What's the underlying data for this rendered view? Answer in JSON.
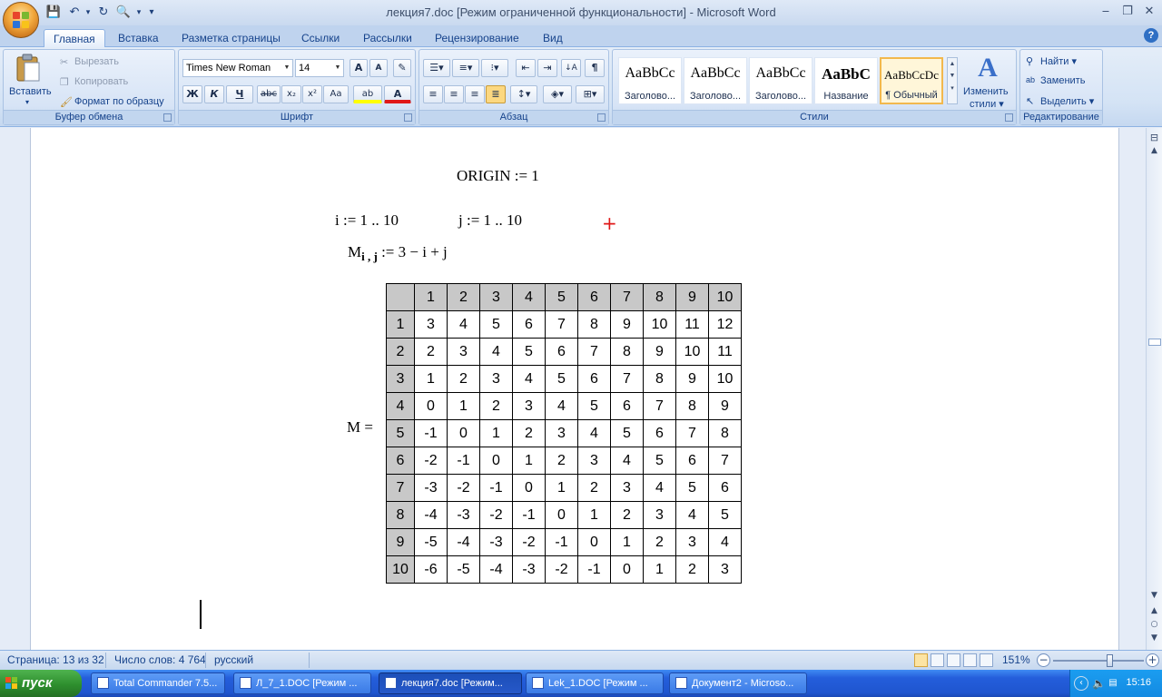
{
  "window": {
    "title": "лекция7.doc [Режим ограниченной функциональности] - Microsoft Word",
    "minimize": "‒",
    "restore": "❐",
    "close": "✕"
  },
  "qat": {
    "save": "💾",
    "undo": "↶",
    "redo": "↻",
    "preview": "🔍",
    "customize": "▾"
  },
  "tabs": [
    "Главная",
    "Вставка",
    "Разметка страницы",
    "Ссылки",
    "Рассылки",
    "Рецензирование",
    "Вид"
  ],
  "ribbon": {
    "clipboard": {
      "label": "Буфер обмена",
      "paste": "Вставить",
      "cut": "Вырезать",
      "copy": "Копировать",
      "format_painter": "Формат по образцу"
    },
    "font": {
      "label": "Шрифт",
      "font_name": "Times New Roman",
      "font_size": "14",
      "grow": "A",
      "shrink": "A",
      "clear": "✎",
      "bold": "Ж",
      "italic": "К",
      "underline": "Ч",
      "strike": "abc",
      "subscript": "x₂",
      "superscript": "x²",
      "case": "Aa",
      "highlight": "ab",
      "color": "A"
    },
    "paragraph": {
      "label": "Абзац",
      "sort": "↓A",
      "pilcrow": "¶"
    },
    "styles": {
      "label": "Стили",
      "items": [
        {
          "sample": "AaBbCc",
          "name": "Заголово..."
        },
        {
          "sample": "AaBbCc",
          "name": "Заголово..."
        },
        {
          "sample": "AaBbCc",
          "name": "Заголово..."
        },
        {
          "sample": "AaBbC",
          "name": "Название"
        },
        {
          "sample": "AaBbCcDc",
          "name": "¶ Обычный"
        }
      ],
      "change_styles_1": "Изменить",
      "change_styles_2": "стили ▾"
    },
    "editing": {
      "label": "Редактирование",
      "find": "Найти ▾",
      "replace": "Заменить",
      "select": "Выделить ▾"
    }
  },
  "document": {
    "origin": "ORIGIN := 1",
    "range_i": "i := 1 .. 10",
    "range_j": "j := 1 .. 10",
    "def_lhs": "M",
    "def_sub": "i , j",
    "def_rhs": " := 3 − i + j",
    "matrix_label": "M =",
    "red_cross": "+",
    "matrix_headers": [
      "1",
      "2",
      "3",
      "4",
      "5",
      "6",
      "7",
      "8",
      "9",
      "10"
    ],
    "matrix_rows": [
      [
        "3",
        "4",
        "5",
        "6",
        "7",
        "8",
        "9",
        "10",
        "11",
        "12"
      ],
      [
        "2",
        "3",
        "4",
        "5",
        "6",
        "7",
        "8",
        "9",
        "10",
        "11"
      ],
      [
        "1",
        "2",
        "3",
        "4",
        "5",
        "6",
        "7",
        "8",
        "9",
        "10"
      ],
      [
        "0",
        "1",
        "2",
        "3",
        "4",
        "5",
        "6",
        "7",
        "8",
        "9"
      ],
      [
        "-1",
        "0",
        "1",
        "2",
        "3",
        "4",
        "5",
        "6",
        "7",
        "8"
      ],
      [
        "-2",
        "-1",
        "0",
        "1",
        "2",
        "3",
        "4",
        "5",
        "6",
        "7"
      ],
      [
        "-3",
        "-2",
        "-1",
        "0",
        "1",
        "2",
        "3",
        "4",
        "5",
        "6"
      ],
      [
        "-4",
        "-3",
        "-2",
        "-1",
        "0",
        "1",
        "2",
        "3",
        "4",
        "5"
      ],
      [
        "-5",
        "-4",
        "-3",
        "-2",
        "-1",
        "0",
        "1",
        "2",
        "3",
        "4"
      ],
      [
        "-6",
        "-5",
        "-4",
        "-3",
        "-2",
        "-1",
        "0",
        "1",
        "2",
        "3"
      ]
    ]
  },
  "scrollbar": {
    "up": "▲",
    "down": "▼",
    "prev": "▲",
    "browse": "○",
    "next": "▼",
    "ruler": "⊟"
  },
  "status": {
    "page": "Страница: 13 из 32",
    "words": "Число слов: 4 764",
    "language": "русский",
    "zoom": "151%",
    "zoom_minus": "−",
    "zoom_plus": "+",
    "zoom_level": 0.63
  },
  "taskbar": {
    "start": "пуск",
    "tasks": [
      "Total Commander 7.5...",
      "Л_7_1.DOC [Режим ...",
      "лекция7.doc [Режим...",
      "Lek_1.DOC [Режим ...",
      "Документ2 - Microso..."
    ],
    "clock": "15:16"
  }
}
